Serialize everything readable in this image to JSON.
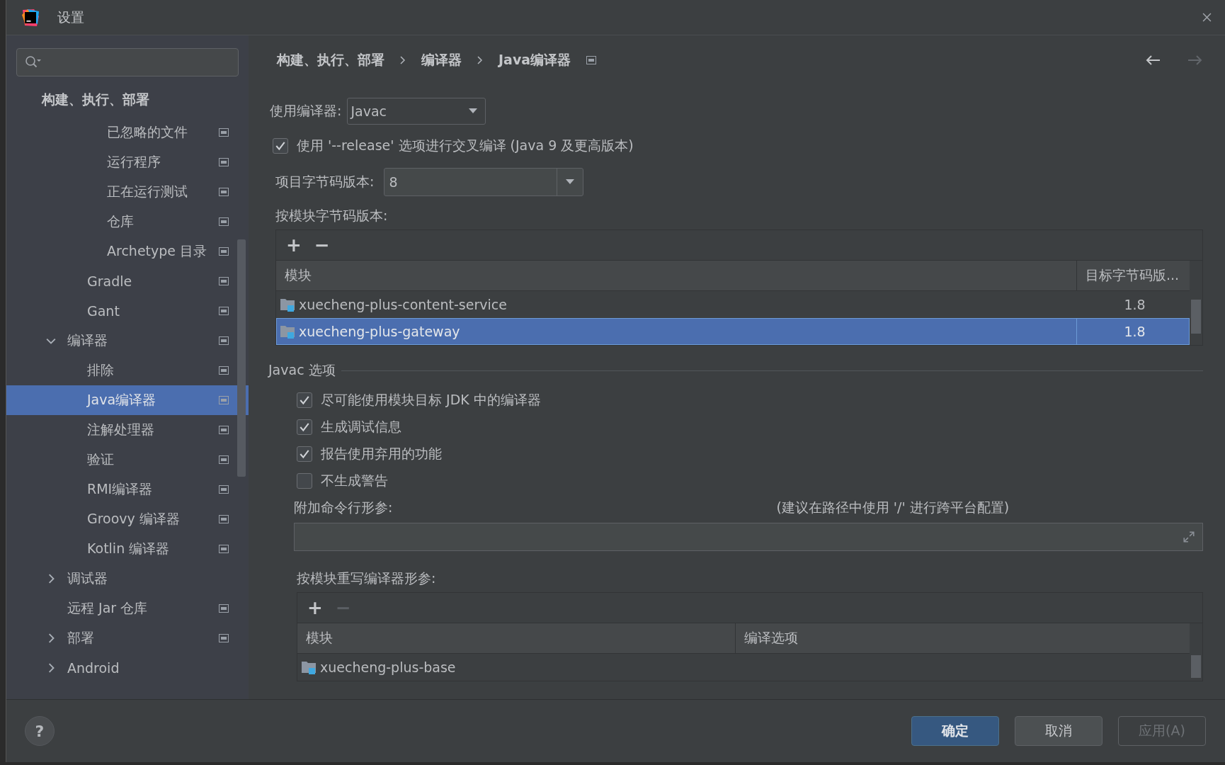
{
  "window": {
    "title": "设置"
  },
  "sidebar": {
    "section_header": "构建、执行、部署",
    "items": [
      {
        "children": [
          {
            "children": [
              {
                "label": "已忽略的文件",
                "project_level": true,
                "selected": false
              },
              {
                "label": "运行程序",
                "project_level": true,
                "selected": false
              },
              {
                "label": "正在运行测试",
                "project_level": true,
                "selected": false
              },
              {
                "label": "仓库",
                "project_level": true,
                "selected": false
              },
              {
                "label": "Archetype 目录",
                "project_level": true,
                "selected": false
              }
            ]
          },
          {
            "label": "Gradle",
            "project_level": true,
            "selected": false
          },
          {
            "label": "Gant",
            "project_level": true,
            "selected": false
          }
        ]
      },
      {
        "label": "编译器",
        "project_level": true,
        "selected": false,
        "expanded": true,
        "children": [
          {
            "label": "排除",
            "project_level": true,
            "selected": false
          },
          {
            "label": "Java编译器",
            "project_level": true,
            "selected": true
          },
          {
            "label": "注解处理器",
            "project_level": true,
            "selected": false
          },
          {
            "label": "验证",
            "project_level": true,
            "selected": false
          },
          {
            "label": "RMI编译器",
            "project_level": true,
            "selected": false
          },
          {
            "label": "Groovy 编译器",
            "project_level": true,
            "selected": false
          },
          {
            "label": "Kotlin 编译器",
            "project_level": true,
            "selected": false
          }
        ]
      },
      {
        "label": "调试器",
        "project_level": false,
        "selected": false,
        "expanded": false
      },
      {
        "label": "远程 Jar 仓库",
        "project_level": true,
        "selected": false
      },
      {
        "label": "部署",
        "project_level": true,
        "selected": false,
        "expanded": false
      },
      {
        "label": "Android",
        "project_level": false,
        "selected": false,
        "expanded": false
      }
    ]
  },
  "breadcrumb": [
    "构建、执行、部署",
    "编译器",
    "Java编译器"
  ],
  "navigation": {
    "back_enabled": true,
    "forward_enabled": false
  },
  "compiler": {
    "label": "使用编译器:",
    "value": "Javac"
  },
  "release_option": {
    "label": "使用 '--release' 选项进行交叉编译 (Java 9 及更高版本)",
    "checked": true
  },
  "bytecode_version": {
    "label": "项目字节码版本:",
    "value": "8"
  },
  "module_bytecode": {
    "label": "按模块字节码版本:",
    "toolbar": [
      {
        "symbol": "+",
        "disabled": false
      },
      {
        "symbol": "−",
        "disabled": false
      }
    ],
    "columns": [
      "模块",
      "目标字节码版..."
    ],
    "rows": [
      {
        "module": "xuecheng-plus-content-service",
        "version": "1.8",
        "selected": false
      },
      {
        "module": "xuecheng-plus-gateway",
        "version": "1.8",
        "selected": true
      }
    ]
  },
  "javac_options": {
    "title": "Javac 选项",
    "checkboxes": [
      {
        "label": "尽可能使用模块目标 JDK 中的编译器",
        "checked": true
      },
      {
        "label": "生成调试信息",
        "checked": true
      },
      {
        "label": "报告使用弃用的功能",
        "checked": true
      },
      {
        "label": "不生成警告",
        "checked": false
      }
    ],
    "args_label": "附加命令行形参:",
    "args_hint": "(建议在路径中使用 '/' 进行跨平台配置)"
  },
  "module_overrides": {
    "label": "按模块重写编译器形参:",
    "toolbar": [
      {
        "symbol": "+",
        "disabled": false
      },
      {
        "symbol": "−",
        "disabled": true
      }
    ],
    "columns": [
      "模块",
      "编译选项"
    ],
    "rows": [
      {
        "module": "xuecheng-plus-base"
      }
    ]
  },
  "help_button": "?",
  "buttons": [
    {
      "label": "确定",
      "kind": "primary",
      "disabled": false
    },
    {
      "label": "取消",
      "kind": "normal",
      "disabled": false
    },
    {
      "label": "应用(A)",
      "kind": "normal",
      "disabled": true
    }
  ]
}
